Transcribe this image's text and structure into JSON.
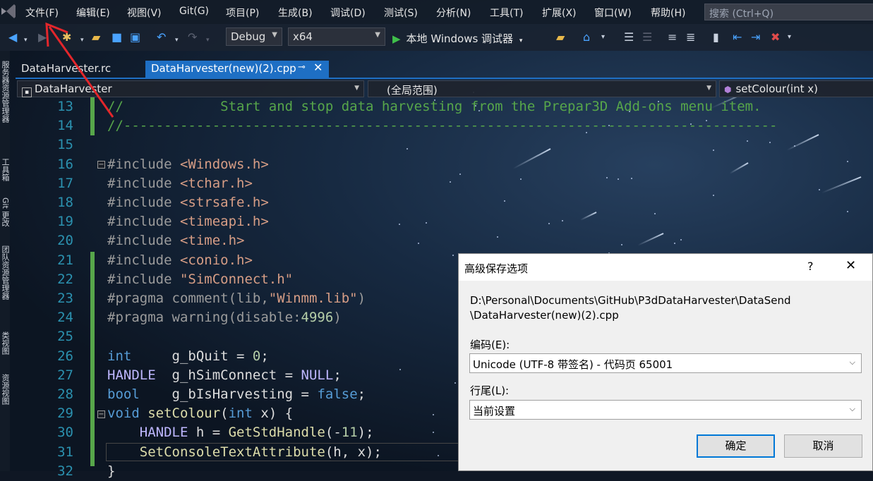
{
  "menubar": {
    "items": [
      "文件(F)",
      "编辑(E)",
      "视图(V)",
      "Git(G)",
      "项目(P)",
      "生成(B)",
      "调试(D)",
      "测试(S)",
      "分析(N)",
      "工具(T)",
      "扩展(X)",
      "窗口(W)",
      "帮助(H)"
    ],
    "search_placeholder": "搜索 (Ctrl+Q)"
  },
  "toolbar": {
    "config": "Debug",
    "platform": "x64",
    "run_label": "本地 Windows 调试器"
  },
  "left_strip": [
    "服务器资源管理器",
    "工具箱",
    "Git 更改",
    "团队资源管理器",
    "类视图",
    "资源视图"
  ],
  "tabs": [
    {
      "label": "DataHarvester.rc",
      "active": false
    },
    {
      "label": "DataHarvester(new)(2).cpp",
      "active": true
    }
  ],
  "navbar": {
    "project": "DataHarvester",
    "scope": "(全局范围)",
    "member": "setColour(int x)"
  },
  "editor": {
    "line_numbers": [
      "13",
      "14",
      "15",
      "16",
      "17",
      "18",
      "19",
      "20",
      "21",
      "22",
      "23",
      "24",
      "25",
      "26",
      "27",
      "28",
      "29",
      "30",
      "31",
      "32"
    ],
    "lines": [
      [
        {
          "t": "//            Start and stop data harvesting from the Prepar3D Add-ons menu item.",
          "c": "cm"
        }
      ],
      [
        {
          "t": "//---------------------------------------------------------------------------------",
          "c": "cm"
        }
      ],
      [],
      [
        {
          "t": "#include ",
          "c": "pp"
        },
        {
          "t": "<Windows.h>",
          "c": "str"
        }
      ],
      [
        {
          "t": "#include ",
          "c": "pp"
        },
        {
          "t": "<tchar.h>",
          "c": "str"
        }
      ],
      [
        {
          "t": "#include ",
          "c": "pp"
        },
        {
          "t": "<strsafe.h>",
          "c": "str"
        }
      ],
      [
        {
          "t": "#include ",
          "c": "pp"
        },
        {
          "t": "<timeapi.h>",
          "c": "str"
        }
      ],
      [
        {
          "t": "#include ",
          "c": "pp"
        },
        {
          "t": "<time.h>",
          "c": "str"
        }
      ],
      [
        {
          "t": "#include ",
          "c": "pp"
        },
        {
          "t": "<conio.h>",
          "c": "str"
        }
      ],
      [
        {
          "t": "#include ",
          "c": "pp"
        },
        {
          "t": "\"SimConnect.h\"",
          "c": "str"
        }
      ],
      [
        {
          "t": "#pragma ",
          "c": "pp"
        },
        {
          "t": "comment(lib,",
          "c": "pp"
        },
        {
          "t": "\"Winmm.lib\"",
          "c": "str"
        },
        {
          "t": ")",
          "c": "pp"
        }
      ],
      [
        {
          "t": "#pragma ",
          "c": "pp"
        },
        {
          "t": "warning(disable:",
          "c": "pp"
        },
        {
          "t": "4996",
          "c": "num"
        },
        {
          "t": ")",
          "c": "pp"
        }
      ],
      [],
      [
        {
          "t": "int",
          "c": "kw"
        },
        {
          "t": "     g_bQuit = ",
          "c": ""
        },
        {
          "t": "0",
          "c": "num"
        },
        {
          "t": ";",
          "c": ""
        }
      ],
      [
        {
          "t": "HANDLE",
          "c": "mac"
        },
        {
          "t": "  g_hSimConnect = ",
          "c": ""
        },
        {
          "t": "NULL",
          "c": "mac"
        },
        {
          "t": ";",
          "c": ""
        }
      ],
      [
        {
          "t": "bool",
          "c": "kw"
        },
        {
          "t": "    g_bIsHarvesting = ",
          "c": ""
        },
        {
          "t": "false",
          "c": "kw"
        },
        {
          "t": ";",
          "c": ""
        }
      ],
      [
        {
          "t": "void ",
          "c": "kw"
        },
        {
          "t": "setColour",
          "c": "fn"
        },
        {
          "t": "(",
          "c": ""
        },
        {
          "t": "int",
          "c": "kw"
        },
        {
          "t": " x) {",
          "c": ""
        }
      ],
      [
        {
          "t": "    HANDLE",
          "c": "mac"
        },
        {
          "t": " h = ",
          "c": ""
        },
        {
          "t": "GetStdHandle",
          "c": "fn"
        },
        {
          "t": "(-",
          "c": ""
        },
        {
          "t": "11",
          "c": "num"
        },
        {
          "t": ");",
          "c": ""
        }
      ],
      [
        {
          "t": "    SetConsoleTextAttribute",
          "c": "fn"
        },
        {
          "t": "(h, x);",
          "c": ""
        }
      ],
      [
        {
          "t": "}",
          "c": ""
        }
      ]
    ]
  },
  "dialog": {
    "title": "高级保存选项",
    "help": "?",
    "path_line1": "D:\\Personal\\Documents\\GitHub\\P3dDataHarvester\\DataSend",
    "path_line2": "\\DataHarvester(new)(2).cpp",
    "encoding_label": "编码(E):",
    "encoding_value": "Unicode (UTF-8 带签名) - 代码页 65001",
    "line_ending_label": "行尾(L):",
    "line_ending_value": "当前设置",
    "ok_label": "确定",
    "cancel_label": "取消"
  }
}
